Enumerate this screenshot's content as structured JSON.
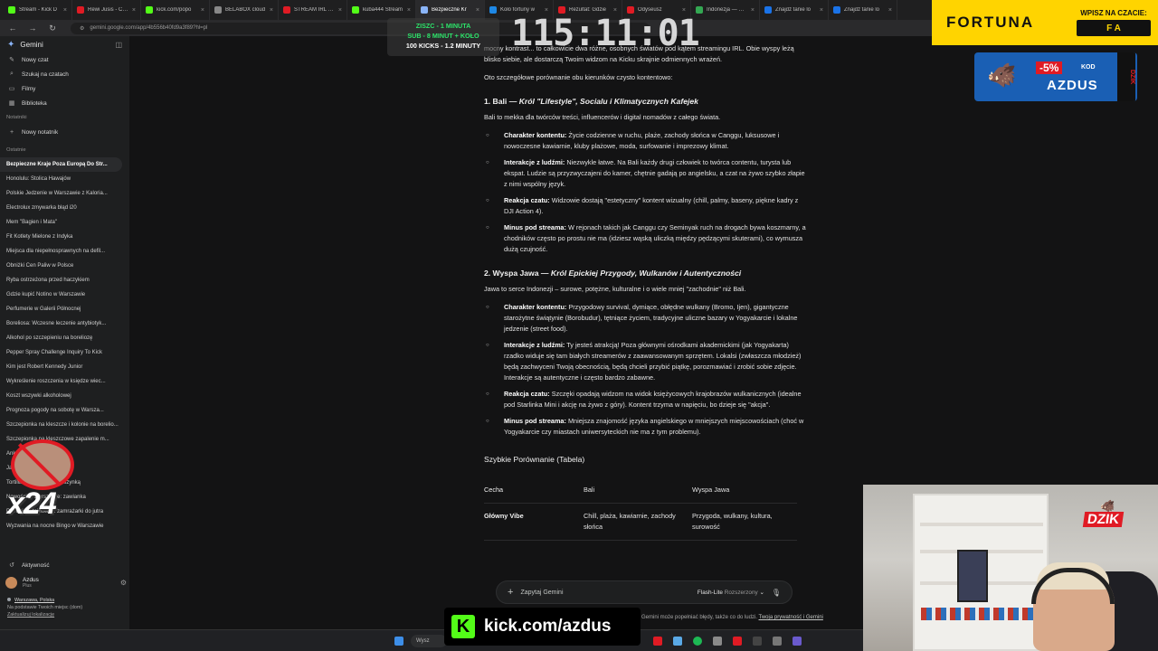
{
  "browser": {
    "tabs": [
      {
        "title": "Stream - Kick D",
        "color": "#53fc18"
      },
      {
        "title": "Rewi Jusis - Cho",
        "color": "#e01b24"
      },
      {
        "title": "kick.com/popo",
        "color": "#53fc18"
      },
      {
        "title": "BELABOX cloud",
        "color": "#888888"
      },
      {
        "title": "STREAM IRL 24/",
        "color": "#e01b24"
      },
      {
        "title": "kuba444 Stream",
        "color": "#53fc18"
      },
      {
        "title": "Bezpieczne Kr",
        "color": "#8ab4f8"
      },
      {
        "title": "Koło fortuny w",
        "color": "#1e88e5"
      },
      {
        "title": "Rezultat: Gdzie",
        "color": "#e01b24"
      },
      {
        "title": "Odyseusz",
        "color": "#e01b24"
      },
      {
        "title": "Indonezja — Mar",
        "color": "#34a853"
      },
      {
        "title": "Znajdź tanie lo",
        "color": "#1a73e8"
      },
      {
        "title": "Znajdź tanie lo",
        "color": "#1a73e8"
      }
    ],
    "url": "gemini.google.com/app/4b556b40fd9a3f89?hl=pl"
  },
  "sidebar": {
    "app_title": "Gemini",
    "actions": [
      {
        "label": "Nowy czat",
        "icon": "new-chat-icon",
        "glyph": "✎"
      },
      {
        "label": "Szukaj na czatach",
        "icon": "search-icon",
        "glyph": "⌕"
      },
      {
        "label": "Filmy",
        "icon": "video-icon",
        "glyph": "▭"
      },
      {
        "label": "Biblioteka",
        "icon": "library-icon",
        "glyph": "▦"
      }
    ],
    "notebooks_header": "Notatniki",
    "new_notebook": "Nowy notatnik",
    "recent_header": "Ostatnie",
    "chats": [
      "Bezpieczne Kraje Poza Europą Do Str...",
      "Honolulu: Stolica Hawajów",
      "Polskie Jedzenie w Warszawie z Kaloria...",
      "Electrolux zmywarka błąd i20",
      "Mem \"Bagien i Mata\"",
      "Fit Kotlety Mielone z Indyka",
      "Miejsca dla niepełnosprawnych na defil...",
      "Obniżki Cen Paliw w Polsce",
      "Ryba ostrzeżona przed haczykiem",
      "Gdzie kupić Notino w Warszawie",
      "Perfumerie w Galerii Północnej",
      "Boreliosa: Wczesne leczenie antybiotyk...",
      "Alkohol po szczepieniu na boreliozę",
      "Pepper Spray Challenge Inquiry To Kick",
      "Kim jest Robert Kennedy Junior",
      "Wykreślenie roszczenia w księdze wiec...",
      "Koszt wszywki alkoholowej",
      "Prognoza pogody na sobotę w Warsza...",
      "Szczepionka na kleszcze i kolonie na borelio...",
      "Szczepionka na kleszczowe zapalenie m...",
      "Ankieta: Przepis na bank",
      "Jak zrobić dobrą pizzę",
      "Tortilla z kurczakiem i z szynką",
      "Nowości w Warszawie: zawianka",
      "Pierogi proteinowe z zamrażarki do jutra",
      "Wyzwania na nocne Bingo w Warszawie"
    ],
    "activity": "Aktywność",
    "user_name": "Azdus",
    "user_plan": "Plus",
    "location_city": "Warszawa, Polska",
    "location_note": "Na podstawie Twoich miejsc (dom)",
    "location_update": "Zaktualizuj lokalizację"
  },
  "article": {
    "intro": "mocny kontrast... to całkowicie dwa różne, osobnych światów pod kątem streamingu IRL. Obie wyspy leżą blisko siebie, ale dostarczą Twoim widzom na Kicku skrajnie odmiennych wrażeń.",
    "lead": "Oto szczegółowe porównanie obu kierunków czysto kontentowo:",
    "sections": [
      {
        "heading_num": "1. Bali — ",
        "heading_title": "Król \"Lifestyle\", Socialu i Klimatycznych Kafejek",
        "subtitle": "Bali to mekka dla twórców treści, influencerów i digital nomadów z całego świata.",
        "bullets": [
          {
            "label": "Charakter kontentu:",
            "text": " Życie codzienne w ruchu, plaże, zachody słońca w Canggu, luksusowe i nowoczesne kawiarnie, kluby plażowe, moda, surfowanie i imprezowy klimat."
          },
          {
            "label": "Interakcje z ludźmi:",
            "text": " Niezwykle łatwe. Na Bali każdy drugi człowiek to twórca contentu, turysta lub ekspat. Ludzie są przyzwyczajeni do kamer, chętnie gadają po angielsku, a czat na żywo szybko złapie z nimi wspólny język."
          },
          {
            "label": "Reakcja czatu:",
            "text": " Widzowie dostają \"estetyczny\" kontent wizualny (chill, palmy, baseny, piękne kadry z DJI Action 4)."
          },
          {
            "label": "Minus pod streama:",
            "text": " W rejonach takich jak Canggu czy Seminyak ruch na drogach bywa koszmarny, a chodników często po prostu nie ma (idziesz wąską uliczką między pędzącymi skuterami), co wymusza dużą czujność."
          }
        ]
      },
      {
        "heading_num": "2. Wyspa Jawa — ",
        "heading_title": "Król Epickiej Przygody, Wulkanów i Autentyczności",
        "subtitle": "Jawa to serce Indonezji – surowe, potężne, kulturalne i o wiele mniej \"zachodnie\" niż Bali.",
        "bullets": [
          {
            "label": "Charakter kontentu:",
            "text": " Przygodowy survival, dymiące, obłędne wulkany (Bromo, Ijen), gigantyczne starożytne świątynie (Borobudur), tętniące życiem, tradycyjne uliczne bazary w Yogyakarcie i lokalne jedzenie (street food)."
          },
          {
            "label": "Interakcje z ludźmi:",
            "text": " Ty jesteś atrakcją! Poza głównymi ośrodkami akademickimi (jak Yogyakarta) rzadko widuje się tam białych streamerów z zaawansowanym sprzętem. Lokalsi (zwłaszcza młodzież) będą zachwyceni Twoją obecnością, będą chcieli przybić piątkę, porozmawiać i zrobić sobie zdjęcie. Interakcje są autentyczne i często bardzo zabawne."
          },
          {
            "label": "Reakcja czatu:",
            "text": " Szczęki opadają widzom na widok księżycowych krajobrazów wulkanicznych (idealne pod Starlinka Mini i akcję na żywo z góry). Kontent trzyma w napięciu, bo dzieje się \"akcja\"."
          },
          {
            "label": "Minus pod streama:",
            "text": " Mniejsza znajomość języka angielskiego w mniejszych miejscowościach (choć w Yogyakarcie czy miastach uniwersyteckich nie ma z tym problemu)."
          }
        ]
      }
    ],
    "table_title": "Szybkie Porównanie (Tabela)",
    "table_headers": [
      "Cecha",
      "Bali",
      "Wyspa Jawa"
    ],
    "table_rows": [
      [
        "Główny Vibe",
        "Chill, plaża, kawiarnie, zachody słońca",
        "Przygoda, wulkany, kultura, surowość"
      ]
    ]
  },
  "composer": {
    "placeholder": "Zapytaj Gemini",
    "model": "Flash-Lite",
    "model_sub": "Rozszerzony",
    "disclaimer_text": "Gemini może popełniać błędy, także co do ludzi. ",
    "disclaimer_link": "Twoja prywatność i Gemini"
  },
  "taskbar": {
    "search_label": "Wysz"
  },
  "overlays": {
    "goal_line1": "ZISZC - 1 MINUTA",
    "goal_line2": "SUB - 8 MINUT + KOŁO",
    "goal_line3": "100 KICKS - 1.2 MINUTY",
    "timer": "115:11:01",
    "sponsor_brand": "FORTUNA",
    "sponsor_prompt": "WPISZ NA CZACIE:",
    "sponsor_code": "F A",
    "promo_discount": "-5%",
    "promo_kod": "KOD",
    "promo_code": "AZDUS",
    "promo_can": "DZIK",
    "webcam_logo": "DZIK",
    "penalty_multiplier": "x24",
    "kick_url": "kick.com/azdus"
  },
  "colors": {
    "background": "#131314",
    "sidebar": "#1e1f20",
    "kick_green": "#53fc18",
    "fortuna_yellow": "#ffd400",
    "dzik_red": "#e01b24"
  }
}
